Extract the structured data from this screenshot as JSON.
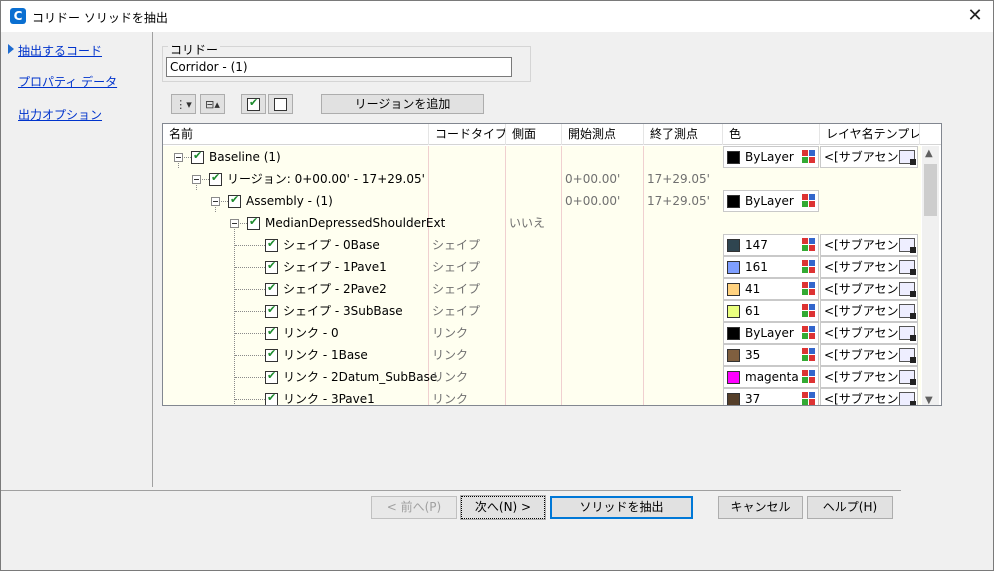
{
  "window": {
    "title": "コリドー ソリッドを抽出",
    "app_icon_letter": "C"
  },
  "nav": {
    "items": [
      "抽出するコード",
      "プロパティ データ",
      "出力オプション"
    ]
  },
  "corridor": {
    "label": "コリドー",
    "value": "Corridor - (1)"
  },
  "toolbar": {
    "add_region_label": "リージョンを追加"
  },
  "grid": {
    "columns": [
      "名前",
      "コードタイプ",
      "側面",
      "開始測点",
      "終了測点",
      "色",
      "レイヤ名テンプレ..."
    ],
    "rows": [
      {
        "name": "Baseline (1)",
        "code_type": "",
        "side": "",
        "start": "",
        "end": "",
        "color_name": "ByLayer",
        "swatch": "#000000",
        "layer": "<[サブアセン..."
      },
      {
        "name": "リージョン: 0+00.00' - 17+29.05'",
        "code_type": "",
        "side": "",
        "start": "0+00.00'",
        "end": "17+29.05'",
        "color_name": "",
        "swatch": "",
        "layer": ""
      },
      {
        "name": "Assembly - (1)",
        "code_type": "",
        "side": "",
        "start": "0+00.00'",
        "end": "17+29.05'",
        "color_name": "ByLayer",
        "swatch": "#000000",
        "layer": ""
      },
      {
        "name": "MedianDepressedShoulderExt",
        "code_type": "",
        "side": "いいえ",
        "start": "",
        "end": "",
        "color_name": "",
        "swatch": "",
        "layer": ""
      },
      {
        "name": "シェイプ - 0Base",
        "code_type": "シェイプ",
        "side": "",
        "start": "",
        "end": "",
        "color_name": "147",
        "swatch": "#2f4550",
        "layer": "<[サブアセン..."
      },
      {
        "name": "シェイプ - 1Pave1",
        "code_type": "シェイプ",
        "side": "",
        "start": "",
        "end": "",
        "color_name": "161",
        "swatch": "#7f9fff",
        "layer": "<[サブアセン..."
      },
      {
        "name": "シェイプ - 2Pave2",
        "code_type": "シェイプ",
        "side": "",
        "start": "",
        "end": "",
        "color_name": "41",
        "swatch": "#ffd27f",
        "layer": "<[サブアセン..."
      },
      {
        "name": "シェイプ - 3SubBase",
        "code_type": "シェイプ",
        "side": "",
        "start": "",
        "end": "",
        "color_name": "61",
        "swatch": "#eaff7f",
        "layer": "<[サブアセン..."
      },
      {
        "name": "リンク - 0",
        "code_type": "リンク",
        "side": "",
        "start": "",
        "end": "",
        "color_name": "ByLayer",
        "swatch": "#000000",
        "layer": "<[サブアセン..."
      },
      {
        "name": "リンク - 1Base",
        "code_type": "リンク",
        "side": "",
        "start": "",
        "end": "",
        "color_name": "35",
        "swatch": "#7f5f3f",
        "layer": "<[サブアセン..."
      },
      {
        "name": "リンク - 2Datum_SubBase",
        "code_type": "リンク",
        "side": "",
        "start": "",
        "end": "",
        "color_name": "magenta",
        "swatch": "#ff00ff",
        "layer": "<[サブアセン..."
      },
      {
        "name": "リンク - 3Pave1",
        "code_type": "リンク",
        "side": "",
        "start": "",
        "end": "",
        "color_name": "37",
        "swatch": "#553f2a",
        "layer": "<[サブアセン..."
      }
    ]
  },
  "footer": {
    "prev": "< 前へ(P)",
    "next": "次へ(N) >",
    "extract": "ソリッドを抽出",
    "cancel": "キャンセル",
    "help": "ヘルプ(H)"
  }
}
